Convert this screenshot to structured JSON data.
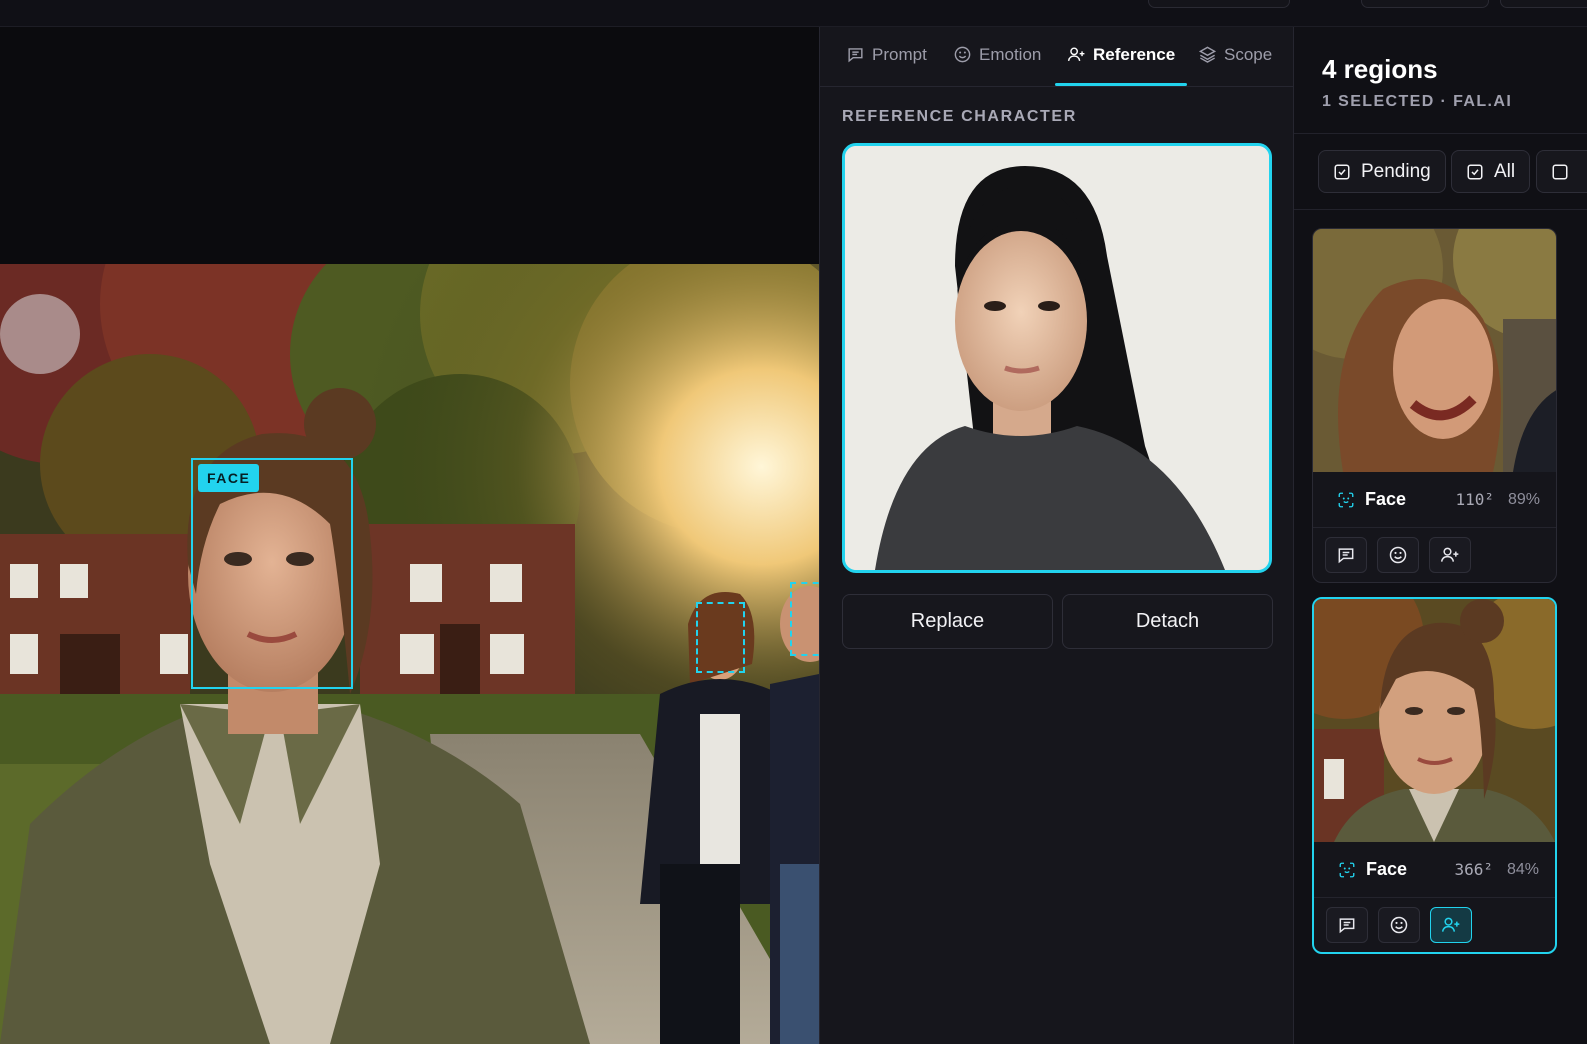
{
  "tabs": [
    {
      "label": "Prompt",
      "icon": "message-square-icon"
    },
    {
      "label": "Emotion",
      "icon": "smile-icon"
    },
    {
      "label": "Reference",
      "icon": "user-plus-icon",
      "active": true
    },
    {
      "label": "Scope",
      "icon": "layers-icon"
    }
  ],
  "reference": {
    "section_title": "REFERENCE CHARACTER",
    "replace_label": "Replace",
    "detach_label": "Detach"
  },
  "canvas": {
    "primary_tag": "FACE"
  },
  "regions": {
    "title": "4 regions",
    "subtitle": "1 SELECTED · FAL.AI",
    "filters": [
      {
        "label": "Pending"
      },
      {
        "label": "All"
      }
    ],
    "cards": [
      {
        "label": "Face",
        "size": "110²",
        "confidence": "89%",
        "selected": false
      },
      {
        "label": "Face",
        "size": "366²",
        "confidence": "84%",
        "selected": true
      }
    ]
  },
  "colors": {
    "accent": "#22d3ee",
    "panel": "#16161c",
    "background": "#0b0b0e"
  }
}
